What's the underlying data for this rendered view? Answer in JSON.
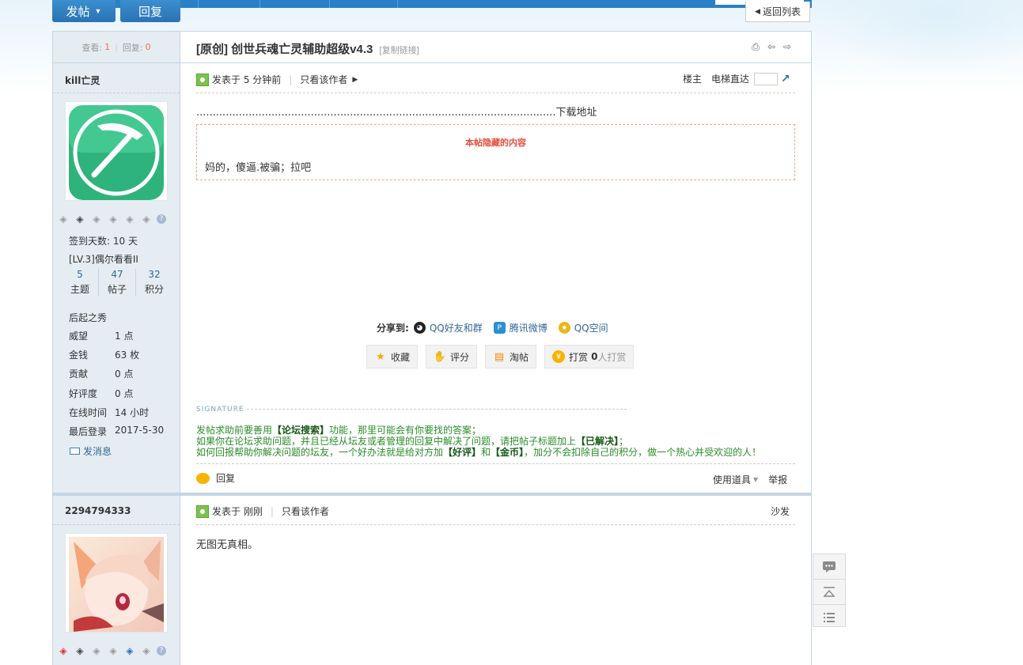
{
  "toolbar": {
    "post_label": "发帖",
    "reply_label": "回复",
    "back_label": "返回列表"
  },
  "thread": {
    "views_label": "查看:",
    "views": "1",
    "replies_label": "回复:",
    "replies": "0",
    "title": "[原创] 创世兵魂亡灵辅助超级v4.3",
    "copy_link": "[复制链接]"
  },
  "post1": {
    "author": "kill亡灵",
    "checkin": "签到天数: 10 天",
    "level": "[LV.3]偶尔看看II",
    "counts": [
      {
        "num": "5",
        "label": "主题"
      },
      {
        "num": "47",
        "label": "帖子"
      },
      {
        "num": "32",
        "label": "积分"
      }
    ],
    "rank": "后起之秀",
    "profile": [
      {
        "key": "威望",
        "value": "1 点"
      },
      {
        "key": "金钱",
        "value": "63 枚"
      },
      {
        "key": "贡献",
        "value": "0 点"
      },
      {
        "key": "好评度",
        "value": "0 点"
      },
      {
        "key": "在线时间",
        "value": "14 小时"
      },
      {
        "key": "最后登录",
        "value": "2017-5-30"
      }
    ],
    "send_msg": "发消息",
    "posted": "发表于 5 分钟前",
    "only_author": "只看该作者",
    "floor": "楼主",
    "elevator": "电梯直达",
    "content": "..............................................................................................................下载地址",
    "hidden_title": "本帖隐藏的内容",
    "hidden_text": "妈的，傻逼.被骗；拉吧",
    "share_label": "分享到:",
    "share_items": [
      "QQ好友和群",
      "腾讯微博",
      "QQ空间"
    ],
    "actions": {
      "favorite": "收藏",
      "rate": "评分",
      "taobao": "淘帖",
      "tip": "打赏",
      "tip_count": "0",
      "tip_suffix": "人打赏"
    },
    "signature_label": "SIGNATURE",
    "signature": [
      {
        "pre": "发帖求助前要善用",
        "b1": "【论坛搜索】",
        "post": "功能，那里可能会有你要找的答案；"
      },
      {
        "pre": "如果你在论坛求助问题，并且已经从坛友或者管理的回复中解决了问题，请把帖子标题加上",
        "b1": "【已解决】",
        "post": "；"
      },
      {
        "pre": "如何回报帮助你解决问题的坛友，一个好办法就是给对方加",
        "b1": "【好评】",
        "mid": "和",
        "b2": "【金币】",
        "post": "，加分不会扣除自己的积分，做一个热心并受欢迎的人！"
      }
    ],
    "reply": "回复",
    "tools": "使用道具",
    "report": "举报"
  },
  "post2": {
    "author": "2294794333",
    "posted": "发表于 刚刚",
    "only_author": "只看该作者",
    "floor": "沙发",
    "content": "无图无真相。"
  },
  "colors": {
    "accent": "#2a80c6",
    "sidebar": "#e5edf2",
    "border": "#c2d5e3",
    "hidden": "#e84c3d",
    "signature": "#2a8c2a"
  },
  "side_tools": [
    "comment-icon",
    "back-to-top-icon",
    "list-icon"
  ]
}
